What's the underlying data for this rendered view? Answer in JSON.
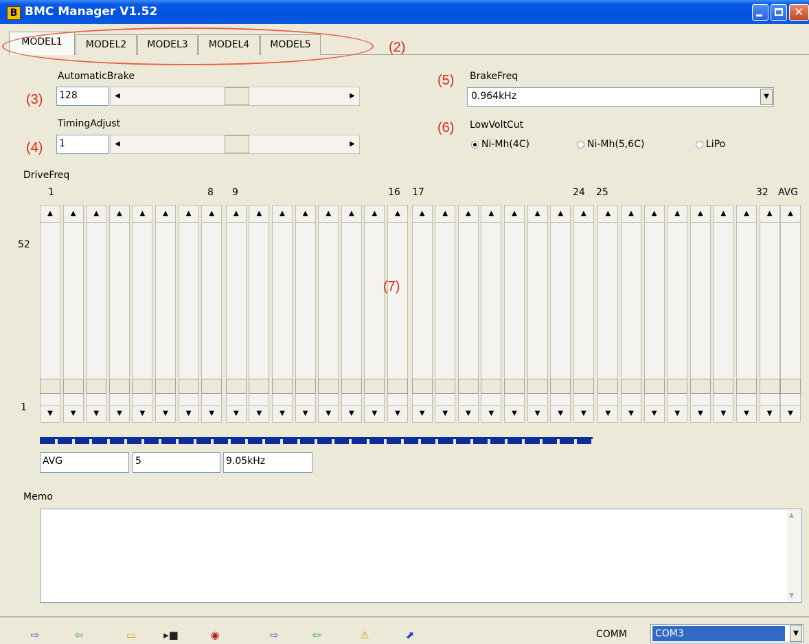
{
  "window": {
    "title": "BMC Manager V1.52",
    "icon_letter": "B"
  },
  "tabs": [
    "MODEL1",
    "MODEL2",
    "MODEL3",
    "MODEL4",
    "MODEL5"
  ],
  "callouts": {
    "tabs": "(2)",
    "auto_brake": "(3)",
    "timing": "(4)",
    "brake_freq": "(5)",
    "low_volt": "(6)",
    "drive_freq": "(7)"
  },
  "automatic_brake": {
    "label": "AutomaticBrake",
    "value": "128",
    "slider_level": 0.5
  },
  "timing_adjust": {
    "label": "TimingAdjust",
    "value": "1",
    "slider_level": 0.5
  },
  "brake_freq": {
    "label": "BrakeFreq",
    "value": "0.964kHz"
  },
  "low_volt_cut": {
    "label": "LowVoltCut",
    "options": [
      "Ni-Mh(4C)",
      "Ni-Mh(5,6C)",
      "LiPo"
    ],
    "selected": 0
  },
  "drive_freq": {
    "label": "DriveFreq",
    "column_labels": [
      "1",
      "8",
      "9",
      "16",
      "17",
      "24",
      "25",
      "32",
      "AVG"
    ],
    "scale_max": "52",
    "scale_min": "1",
    "slider_count": 33
  },
  "summary": {
    "name": "AVG",
    "value": "5",
    "freq": "9.05kHz"
  },
  "memo": {
    "label": "Memo",
    "text": ""
  },
  "toolbar": {
    "icons": [
      "send-icon",
      "receive-icon",
      "open-folder-icon",
      "save-icon",
      "stop-icon",
      "send-icon",
      "receive-icon",
      "warning-icon",
      "graph-icon"
    ],
    "comm_label": "COMM",
    "comm_value": "COM3"
  }
}
